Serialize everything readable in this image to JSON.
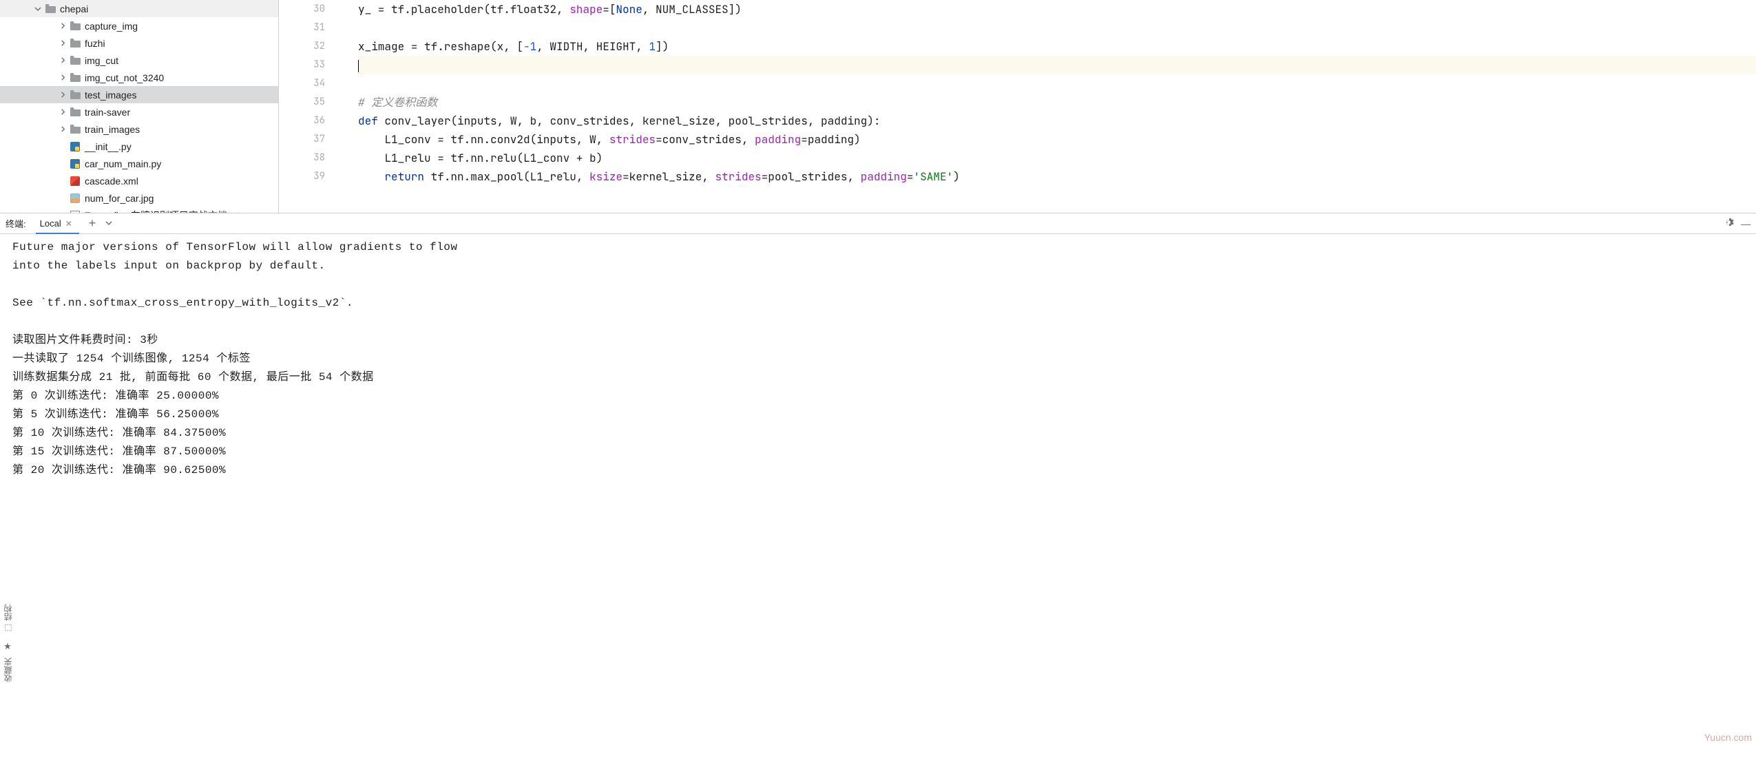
{
  "sidebar": {
    "root": "chepai",
    "items": [
      {
        "label": "capture_img",
        "type": "folder",
        "indent": 2
      },
      {
        "label": "fuzhi",
        "type": "folder",
        "indent": 2
      },
      {
        "label": "img_cut",
        "type": "folder",
        "indent": 2
      },
      {
        "label": "img_cut_not_3240",
        "type": "folder",
        "indent": 2
      },
      {
        "label": "test_images",
        "type": "folder",
        "indent": 2,
        "selected": true
      },
      {
        "label": "train-saver",
        "type": "folder",
        "indent": 2
      },
      {
        "label": "train_images",
        "type": "folder",
        "indent": 2
      },
      {
        "label": "__init__.py",
        "type": "py",
        "indent": 2
      },
      {
        "label": "car_num_main.py",
        "type": "py",
        "indent": 2
      },
      {
        "label": "cascade.xml",
        "type": "xml",
        "indent": 2
      },
      {
        "label": "num_for_car.jpg",
        "type": "jpg",
        "indent": 2
      },
      {
        "label": "Tensorflow车牌识别项目实战文档.txt",
        "type": "txt",
        "indent": 2
      }
    ]
  },
  "editor": {
    "lines": [
      {
        "num": 30,
        "html": "y_ = tf.placeholder(tf.float32, <span class='tok-arg'>shape</span>=[<span class='tok-kw'>None</span>, NUM_CLASSES])"
      },
      {
        "num": 31,
        "html": ""
      },
      {
        "num": 32,
        "html": "x_image = tf.reshape(x, [<span class='tok-num'>-1</span>, WIDTH, HEIGHT, <span class='tok-num'>1</span>])"
      },
      {
        "num": 33,
        "html": "<span class='cursor-caret'></span>",
        "hl": true
      },
      {
        "num": 34,
        "html": ""
      },
      {
        "num": 35,
        "html": "<span class='tok-comment'># 定义卷积函数</span>"
      },
      {
        "num": 36,
        "html": "<span class='tok-kw'>def</span> <span class='tok-def'>conv_layer</span>(inputs, W, b, conv_strides, kernel_size, pool_strides, padding):",
        "marker": "minus"
      },
      {
        "num": 37,
        "html": "    L1_conv = tf.nn.conv2d(inputs, W, <span class='tok-arg'>strides</span>=conv_strides, <span class='tok-arg'>padding</span>=padding)"
      },
      {
        "num": 38,
        "html": "    L1_relu = tf.nn.relu(L1_conv + b)"
      },
      {
        "num": 39,
        "html": "    <span class='tok-kw'>return</span> tf.nn.max_pool(L1_relu, <span class='tok-arg'>ksize</span>=kernel_size, <span class='tok-arg'>strides</span>=pool_strides, <span class='tok-arg'>padding</span>=<span class='tok-str'>'SAME'</span>)",
        "marker": "hint"
      }
    ]
  },
  "terminal": {
    "title": "终端:",
    "tab": "Local",
    "output": [
      "Future major versions of TensorFlow will allow gradients to flow",
      "into the labels input on backprop by default.",
      "",
      "See `tf.nn.softmax_cross_entropy_with_logits_v2`.",
      "",
      "读取图片文件耗费时间: 3秒",
      "一共读取了 1254 个训练图像, 1254 个标签",
      "训练数据集分成 21 批, 前面每批 60 个数据, 最后一批 54 个数据",
      "第 0 次训练迭代: 准确率 25.00000%",
      "第 5 次训练迭代: 准确率 56.25000%",
      "第 10 次训练迭代: 准确率 84.37500%",
      "第 15 次训练迭代: 准确率 87.50000%",
      "第 20 次训练迭代: 准确率 90.62500%"
    ]
  },
  "verttabs": {
    "structure": "结构",
    "favorites": "收藏夹"
  },
  "watermark": "Yuucn.com"
}
